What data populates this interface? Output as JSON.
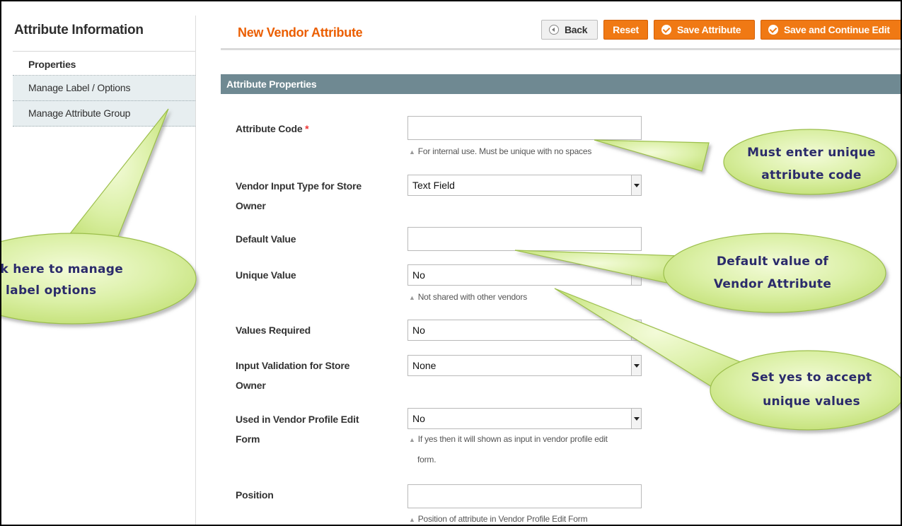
{
  "sidebar": {
    "title": "Attribute Information",
    "tabs": [
      {
        "label": "Properties",
        "active": true
      },
      {
        "label": "Manage Label / Options",
        "active": false
      },
      {
        "label": "Manage Attribute Group",
        "active": false
      }
    ]
  },
  "header": {
    "title": "New Vendor Attribute",
    "buttons": {
      "back": "Back",
      "reset": "Reset",
      "save": "Save Attribute",
      "save_continue": "Save and Continue Edit"
    }
  },
  "section": {
    "title": "Attribute Properties"
  },
  "form": {
    "attribute_code": {
      "label": "Attribute Code",
      "required_mark": "*",
      "value": "",
      "hint": "For internal use. Must be unique with no spaces"
    },
    "vendor_input_type": {
      "label_line1": "Vendor Input Type for Store",
      "label_line2": "Owner",
      "value": "Text Field"
    },
    "default_value": {
      "label": "Default Value",
      "value": ""
    },
    "unique_value": {
      "label": "Unique Value",
      "value": "No",
      "hint": "Not shared with other vendors"
    },
    "values_required": {
      "label": "Values Required",
      "value": "No"
    },
    "input_validation": {
      "label_line1": "Input Validation for Store",
      "label_line2": "Owner",
      "value": "None"
    },
    "used_in_profile": {
      "label_line1": "Used in Vendor Profile Edit",
      "label_line2": "Form",
      "value": "No",
      "hint_line1": "If yes then it will shown as input in vendor profile edit",
      "hint_line2": "form."
    },
    "position": {
      "label": "Position",
      "value": "",
      "hint": "Position of attribute in Vendor Profile Edit Form"
    }
  },
  "callouts": {
    "manage_labels": {
      "line1": "ck here to manage",
      "line2": "e label options"
    },
    "unique_code": {
      "line1": "Must enter unique",
      "line2": "attribute code"
    },
    "default_value": {
      "line1": "Default value of",
      "line2": "Vendor Attribute"
    },
    "unique_values": {
      "line1": "Set yes to accept",
      "line2": "unique values"
    }
  },
  "colors": {
    "accent_orange": "#f07914",
    "title_orange": "#eb5e00",
    "section_header": "#6f8992",
    "callout_fill": "#d8ee9f",
    "callout_text": "#2b2b6b"
  }
}
